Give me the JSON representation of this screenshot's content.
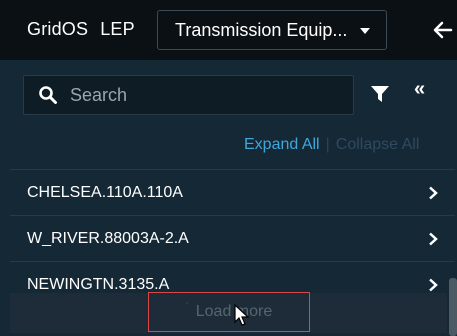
{
  "header": {
    "brand": "GridOS",
    "app_name": "LEP",
    "dropdown_value": "Transmission Equip..."
  },
  "search": {
    "placeholder": "Search"
  },
  "tree_controls": {
    "expand_all": "Expand All",
    "separator": "|",
    "collapse_all": "Collapse All"
  },
  "list": {
    "items": [
      {
        "label": "CHELSEA.110A.110A"
      },
      {
        "label": "W_RIVER.88003A-2.A"
      },
      {
        "label": "NEWINGTN.3135.A"
      }
    ],
    "load_more": "Load more",
    "load_more_marker": "˙"
  },
  "icons": {
    "back": "arrow-left-icon",
    "search": "search-icon",
    "filter": "filter-icon",
    "collapse_panel": "double-chevron-left-icon",
    "chevron": "chevron-right-icon"
  },
  "colors": {
    "header_bg": "#0b1014",
    "panel_bg": "#152836",
    "accent": "#3fa7dc",
    "highlight_box": "#d84848"
  }
}
